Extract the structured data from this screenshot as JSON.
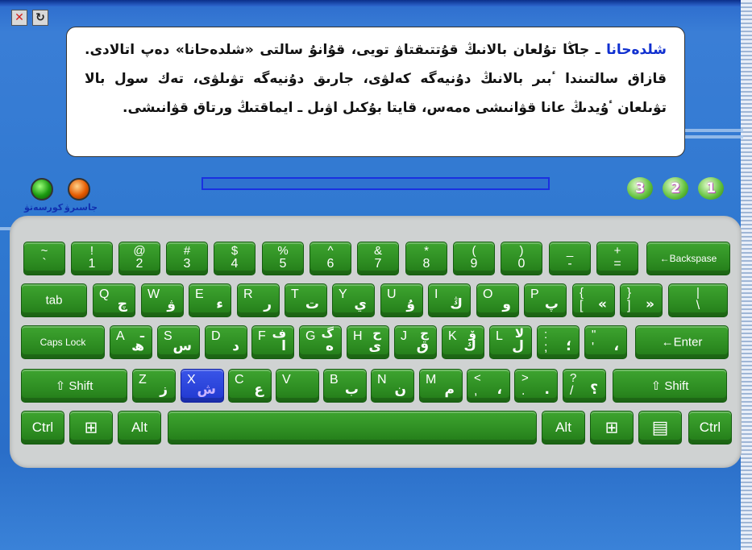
{
  "window": {
    "close_icon": "✕",
    "reset_icon": "↻"
  },
  "lesson_text": {
    "highlight": "شلدەحانا",
    "body": " ـ جاڭا تۇلعان بالانىڭ قۇتتىقتاۋ تويى، قۇانۇ سالتى «شلدەحانا» دەپ اتالادى. قازاق سالتىندا ٴبىر بالانىڭ دۇنيەگە كەلۋى، جارىق دۇنيەگە تۋىلۋى، تەك سول بالا تۋىلعان ٴۇيدىڭ عانا قۋانىشى ەمەس، قايتا بۇكىل اۋىل ـ ايماقتىڭ ورتاق قۋانىشى."
  },
  "progress": {
    "value": 0
  },
  "controls": {
    "green_label": "كورسەتۋ",
    "orange_label": "جاسىرۋ"
  },
  "levels": [
    "3",
    "2",
    "1"
  ],
  "keyboard": {
    "row1": [
      {
        "t": "~",
        "b": "`"
      },
      {
        "t": "!",
        "b": "1"
      },
      {
        "t": "@",
        "b": "2"
      },
      {
        "t": "#",
        "b": "3"
      },
      {
        "t": "$",
        "b": "4"
      },
      {
        "t": "%",
        "b": "5"
      },
      {
        "t": "^",
        "b": "6"
      },
      {
        "t": "&",
        "b": "7"
      },
      {
        "t": "*",
        "b": "8"
      },
      {
        "t": "(",
        "b": "9"
      },
      {
        "t": ")",
        "b": "0"
      },
      {
        "t": "_",
        "b": "-"
      },
      {
        "t": "+",
        "b": "="
      },
      {
        "c": "←Backspase"
      }
    ],
    "row2": [
      {
        "c": "tab"
      },
      {
        "l": "Q",
        "r": "چ"
      },
      {
        "l": "W",
        "r": "ۋ"
      },
      {
        "l": "E",
        "r": "ء"
      },
      {
        "l": "R",
        "r": "ر"
      },
      {
        "l": "T",
        "r": "ت"
      },
      {
        "l": "Y",
        "r": "ي"
      },
      {
        "l": "U",
        "r": "ۇ"
      },
      {
        "l": "I",
        "r": "ڭ"
      },
      {
        "l": "O",
        "r": "و"
      },
      {
        "l": "P",
        "r": "پ"
      },
      {
        "t": "{",
        "b": "[",
        "r": "«"
      },
      {
        "t": "}",
        "b": "]",
        "r": "»"
      },
      {
        "t": "|",
        "b": "\\"
      }
    ],
    "row3": [
      {
        "c": "Caps Lock"
      },
      {
        "l": "A",
        "r": "ھ"
      },
      {
        "l": "S",
        "r": "س"
      },
      {
        "l": "D",
        "r": "د"
      },
      {
        "l": "F",
        "r": "ا"
      },
      {
        "l": "G",
        "r": "ە"
      },
      {
        "l": "H",
        "r": "ى"
      },
      {
        "l": "J",
        "r": "ق"
      },
      {
        "l": "K",
        "r": "ك"
      },
      {
        "l": "L",
        "r": "ل"
      },
      {
        "t": ":",
        "b": ";",
        "r": "؛"
      },
      {
        "t": "\"",
        "b": "'",
        "r": "،"
      },
      {
        "c": "←Enter"
      }
    ],
    "row3_alt": [
      "ـ",
      "",
      "",
      "ف",
      "گ",
      "ح",
      "ج",
      "ۆ",
      "لا"
    ],
    "row4": [
      {
        "c": "⇧ Shift"
      },
      {
        "l": "Z",
        "r": "ز"
      },
      {
        "l": "X",
        "r": "ش",
        "active": true
      },
      {
        "l": "C",
        "r": "ع"
      },
      {
        "l": "V",
        "r": ""
      },
      {
        "l": "B",
        "r": "ب"
      },
      {
        "l": "N",
        "r": "ن"
      },
      {
        "l": "M",
        "r": "م"
      },
      {
        "t": "<",
        "b": ",",
        "r": "،"
      },
      {
        "t": ">",
        "b": ".",
        "r": "."
      },
      {
        "t": "?",
        "b": "/",
        "r": "؟"
      },
      {
        "c": "⇧ Shift"
      }
    ],
    "row5": [
      {
        "c": "Ctrl"
      },
      {
        "c": "⊞"
      },
      {
        "c": "Alt"
      },
      {
        "c": ""
      },
      {
        "c": "Alt"
      },
      {
        "c": "⊞"
      },
      {
        "c": "▤"
      },
      {
        "c": "Ctrl"
      }
    ]
  }
}
